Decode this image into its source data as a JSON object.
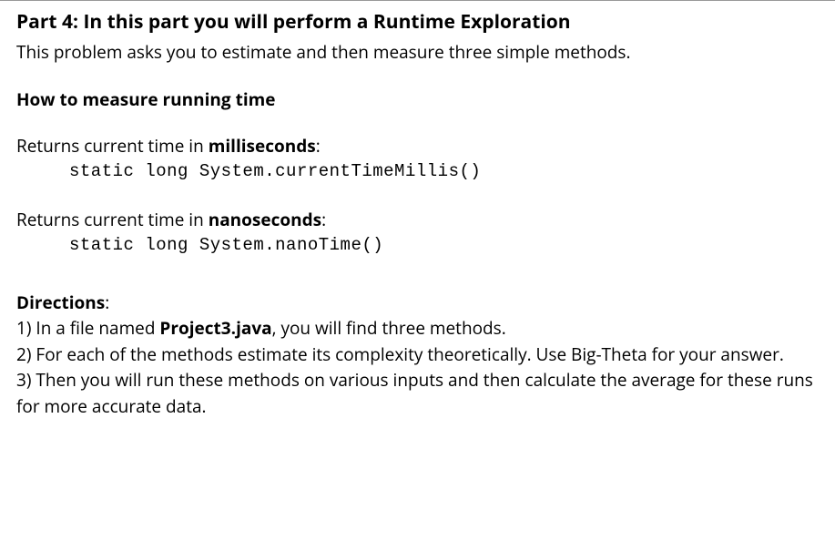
{
  "heading": {
    "prefix": "Part 4:  ",
    "title": "In this part you will perform a Runtime Exploration"
  },
  "intro": "This problem asks you to estimate and then measure three simple methods.",
  "subheading": "How to measure running time",
  "method1": {
    "prefix": "Returns current time in ",
    "unit": "milliseconds",
    "suffix": ":",
    "code": "static long System.currentTimeMillis()"
  },
  "method2": {
    "prefix": "Returns current time in ",
    "unit": "nanoseconds",
    "suffix": ":",
    "code": "static long System.nanoTime()"
  },
  "directions": {
    "label": "Directions",
    "colon": ":",
    "items": [
      {
        "prefix": "1) In a file named ",
        "bold": "Project3.java",
        "suffix": ", you will find three methods."
      },
      {
        "text": "2) For each of the methods estimate its complexity theoretically. Use Big-Theta for your answer."
      },
      {
        "text": "3) Then you will run these methods on various inputs and then calculate the average for these runs for more accurate data."
      }
    ]
  }
}
